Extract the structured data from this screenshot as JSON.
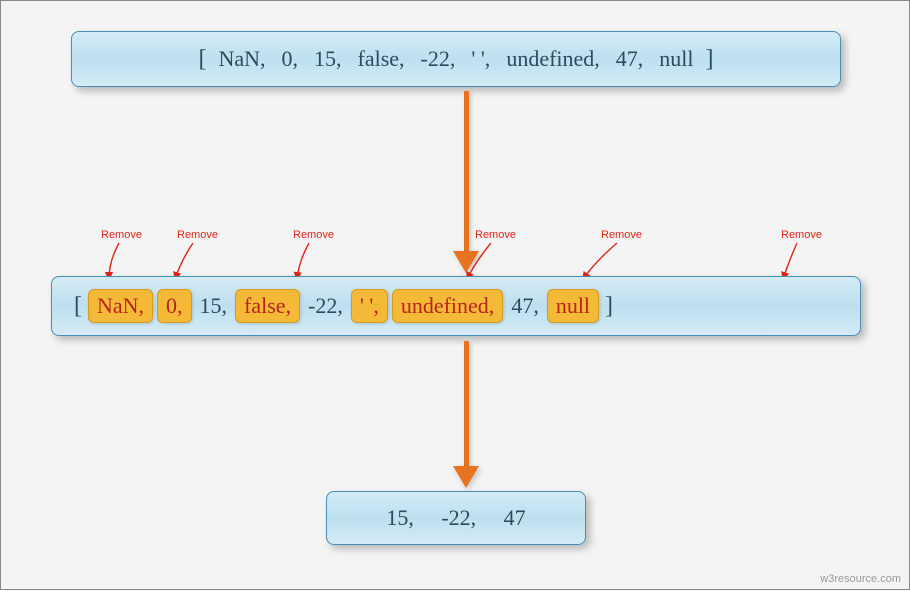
{
  "box1": {
    "open": "[",
    "items": [
      "NaN,",
      "0,",
      "15,",
      "false,",
      "-22,",
      "'   ',",
      "undefined,",
      "47,",
      "null"
    ],
    "close": "]"
  },
  "box2": {
    "open": "[",
    "items": [
      {
        "text": "NaN,",
        "remove": true
      },
      {
        "text": "0,",
        "remove": true
      },
      {
        "text": "15,",
        "remove": false
      },
      {
        "text": "false,",
        "remove": true
      },
      {
        "text": "-22,",
        "remove": false
      },
      {
        "text": "'   ',",
        "remove": true
      },
      {
        "text": "undefined,",
        "remove": true
      },
      {
        "text": "47,",
        "remove": false
      },
      {
        "text": "null",
        "remove": true
      }
    ],
    "close": "]",
    "removeLabel": "Remove"
  },
  "box3": "15,     -22,     47",
  "attribution": "w3resource.com",
  "removePositions": [
    {
      "labelLeft": 95,
      "pillCx": 105
    },
    {
      "labelLeft": 172,
      "pillCx": 170
    },
    {
      "labelLeft": 285,
      "pillCx": 290
    },
    {
      "labelLeft": 470,
      "pillCx": 460
    },
    {
      "labelLeft": 595,
      "pillCx": 575
    },
    {
      "labelLeft": 775,
      "pillCx": 775
    }
  ]
}
